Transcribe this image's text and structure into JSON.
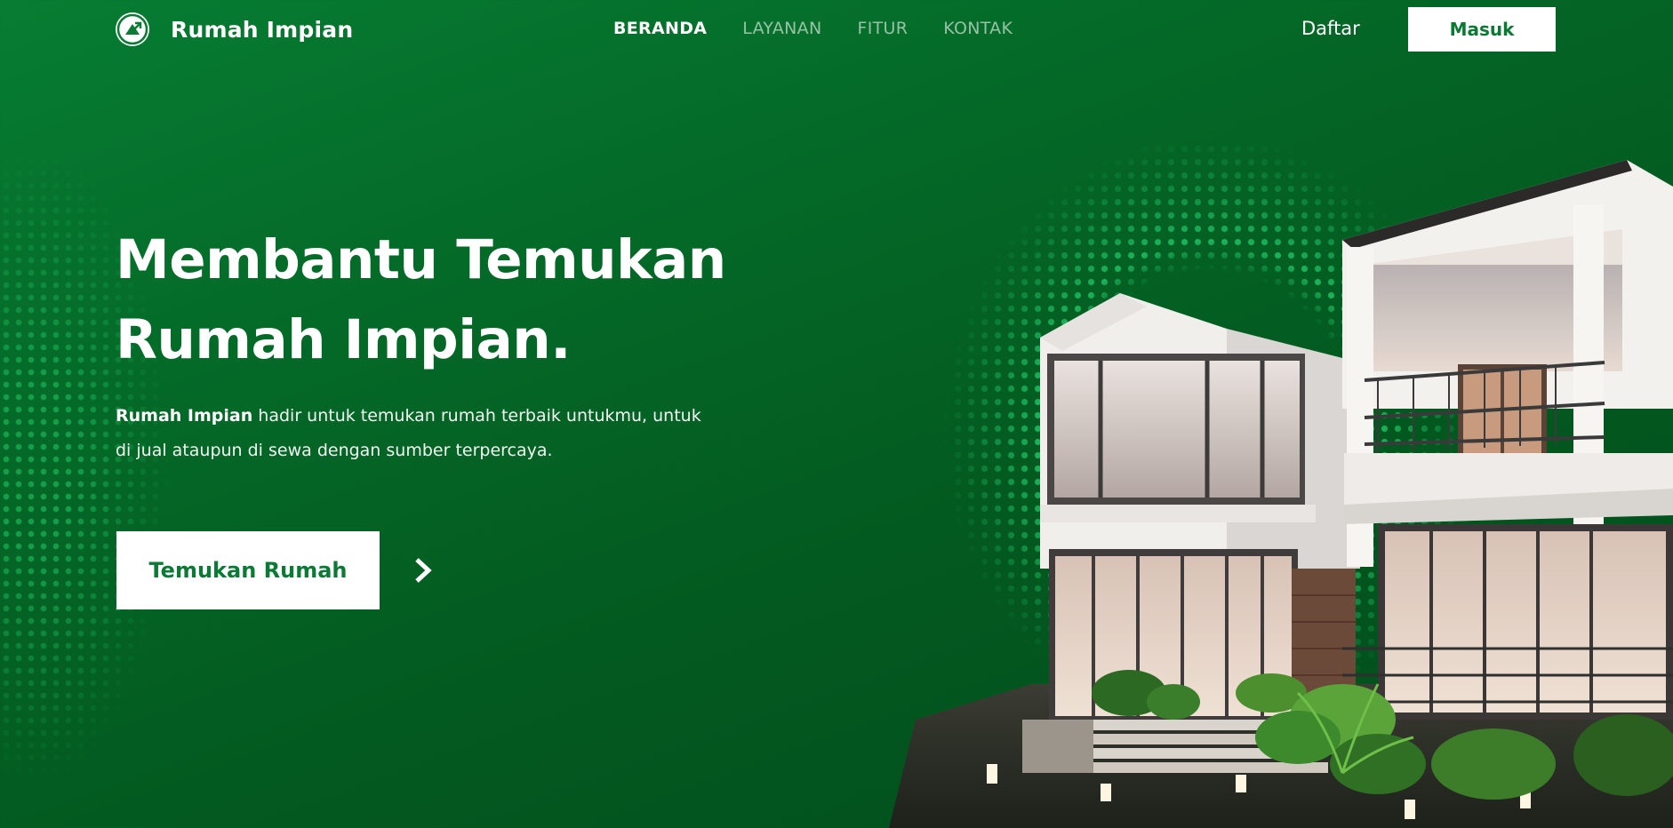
{
  "brand": {
    "name": "Rumah Impian",
    "accent_color": "#0b7a34",
    "background_color": "#046a28",
    "icon": "brand-logo-icon"
  },
  "nav": {
    "items": [
      {
        "label": "BERANDA",
        "active": true
      },
      {
        "label": "LAYANAN",
        "active": false
      },
      {
        "label": "FITUR",
        "active": false
      },
      {
        "label": "KONTAK",
        "active": false
      }
    ],
    "register_label": "Daftar",
    "login_label": "Masuk"
  },
  "hero": {
    "title_line1": "Membantu Temukan",
    "title_line2": "Rumah Impian.",
    "desc_bold": "Rumah Impian",
    "desc_rest_line1": " hadir untuk temukan rumah terbaik untukmu, untuk",
    "desc_line2": "di jual ataupun di sewa dengan sumber terpercaya.",
    "cta_label": "Temukan Rumah",
    "cta_arrow_icon": "chevron-right-icon"
  }
}
